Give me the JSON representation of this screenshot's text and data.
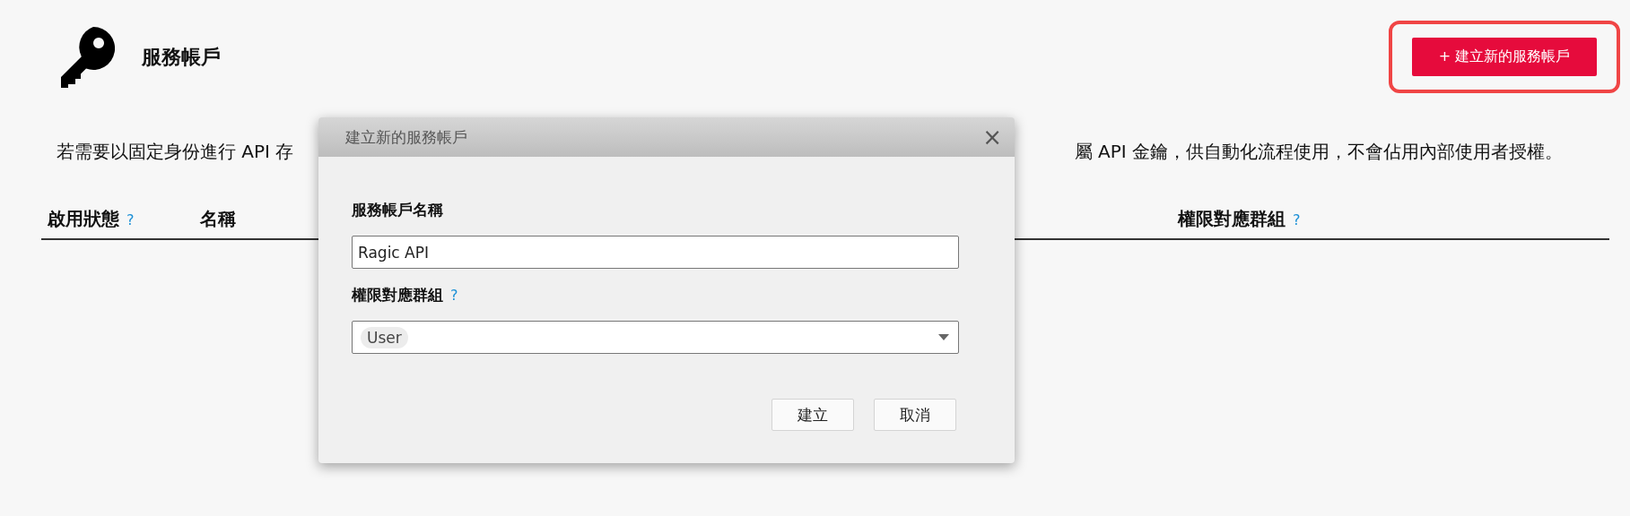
{
  "page": {
    "title": "服務帳戶",
    "create_button": "+ 建立新的服務帳戶",
    "create_button_highlighted": true
  },
  "description": [
    "若需要以固定身份進行 API 存",
    "屬 API 金鑰，供自動化流程使用，不會佔用內部使用者授權。"
  ],
  "table": {
    "columns": [
      {
        "label": "啟用狀態",
        "help": "?"
      },
      {
        "label": "名稱"
      },
      {
        "label": "權限對應群組",
        "help": "?"
      }
    ]
  },
  "dialog": {
    "title": "建立新的服務帳戶",
    "close": "×",
    "name_label": "服務帳戶名稱",
    "name_value": "Ragic API",
    "group_label": "權限對應群組",
    "group_help": "?",
    "group_tags": [
      "User"
    ],
    "buttons": [
      "建立",
      "取消"
    ]
  }
}
